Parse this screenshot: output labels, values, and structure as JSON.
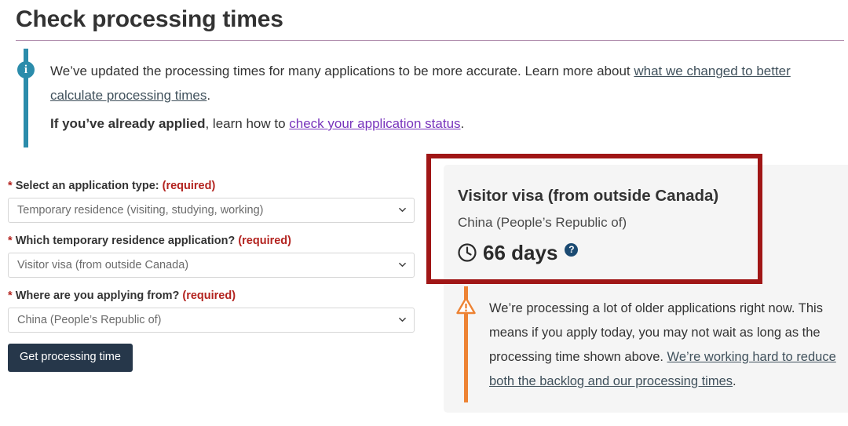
{
  "page": {
    "title": "Check processing times"
  },
  "info_banner": {
    "icon": "info-icon",
    "line1_before": "We’ve updated the processing times for many applications to be more accurate. Learn more about ",
    "line1_link": "what we changed to better calculate processing times",
    "line1_after": ".",
    "line2_bold": "If you’ve already applied",
    "line2_middle": ", learn how to ",
    "line2_link": "check your application status",
    "line2_after": "."
  },
  "form": {
    "fields": [
      {
        "label": "Select an application type:",
        "required_text": "(required)",
        "value": "Temporary residence (visiting, studying, working)"
      },
      {
        "label": "Which temporary residence application?",
        "required_text": "(required)",
        "value": "Visitor visa (from outside Canada)"
      },
      {
        "label": "Where are you applying from?",
        "required_text": "(required)",
        "value": "China (People’s Republic of)"
      }
    ],
    "submit_label": "Get processing time",
    "required_marker": "*"
  },
  "result": {
    "title": "Visitor visa (from outside Canada)",
    "country": "China (People’s Republic of)",
    "clock_icon": "clock-icon",
    "days": "66 days",
    "help_badge": "?",
    "warning": {
      "icon": "warning-triangle-icon",
      "text_before": "We’re processing a lot of older applications right now. This means if you apply today, you may not wait as long as the processing time shown above. ",
      "link": "We’re working hard to reduce both the backlog and our processing times",
      "text_after": "."
    }
  },
  "annotation": {
    "highlight_color": "#a01616"
  },
  "colors": {
    "accent_teal": "#2b8cab",
    "required_red": "#b3231f",
    "button_navy": "#26374a",
    "warning_orange": "#ed8334",
    "help_badge_navy": "#1b4a72",
    "card_background": "#f5f5f5",
    "rule_mauve": "#af8cac",
    "visited_link_purple": "#7834bc",
    "dark_link": "#40515c"
  }
}
